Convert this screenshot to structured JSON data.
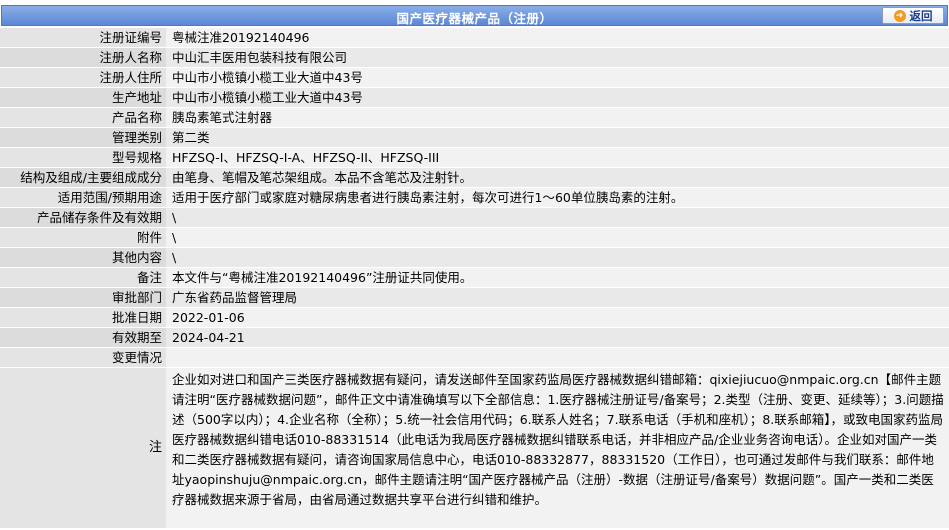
{
  "header": {
    "title": "国产医疗器械产品（注册）",
    "back_label": "返回"
  },
  "fields": [
    {
      "label": "注册证编号",
      "value": "粤械注准20192140496"
    },
    {
      "label": "注册人名称",
      "value": "中山汇丰医用包装科技有限公司"
    },
    {
      "label": "注册人住所",
      "value": "中山市小榄镇小榄工业大道中43号"
    },
    {
      "label": "生产地址",
      "value": "中山市小榄镇小榄工业大道中43号"
    },
    {
      "label": "产品名称",
      "value": "胰岛素笔式注射器"
    },
    {
      "label": "管理类别",
      "value": "第二类"
    },
    {
      "label": "型号规格",
      "value": "HFZSQ-I、HFZSQ-I-A、HFZSQ-II、HFZSQ-III"
    },
    {
      "label": "结构及组成/主要组成成分",
      "value": "由笔身、笔帽及笔芯架组成。本品不含笔芯及注射针。"
    },
    {
      "label": "适用范围/预期用途",
      "value": "适用于医疗部门或家庭对糖尿病患者进行胰岛素注射，每次可进行1～60单位胰岛素的注射。"
    },
    {
      "label": "产品储存条件及有效期",
      "value": "\\"
    },
    {
      "label": "附件",
      "value": "\\"
    },
    {
      "label": "其他内容",
      "value": "\\"
    },
    {
      "label": "备注",
      "value": "本文件与“粤械注准20192140496”注册证共同使用。"
    },
    {
      "label": "审批部门",
      "value": "广东省药品监督管理局"
    },
    {
      "label": "批准日期",
      "value": "2022-01-06"
    },
    {
      "label": "有效期至",
      "value": "2024-04-21"
    },
    {
      "label": "变更情况",
      "value": ""
    }
  ],
  "note": {
    "label": "注",
    "text": "企业如对进口和国产三类医疗器械数据有疑问，请发送邮件至国家药监局医疗器械数据纠错邮箱：qixiejiucuo@nmpaic.org.cn【邮件主题请注明“医疗器械数据问题”，邮件正文中请准确填写以下全部信息：1.医疗器械注册证号/备案号；2.类型（注册、变更、延续等）；3.问题描述（500字以内）；4.企业名称（全称）；5.统一社会信用代码；6.联系人姓名；7.联系电话（手机和座机）；8.联系邮箱】，或致电国家药监局医疗器械数据纠错电话010-88331514（此电话为我局医疗器械数据纠错联系电话，并非相应产品/企业业务咨询电话）。企业如对国产一类和二类医疗器械数据有疑问，请咨询国家局信息中心，电话010-88332877，88331520（工作日），也可通过发邮件与我们联系：邮件地址yaopinshuju@nmpaic.org.cn，邮件主题请注明“国产医疗器械产品（注册）-数据（注册证号/备案号）数据问题”。国产一类和二类医疗器械数据来源于省局，由省局通过数据共享平台进行纠错和维护。"
  }
}
